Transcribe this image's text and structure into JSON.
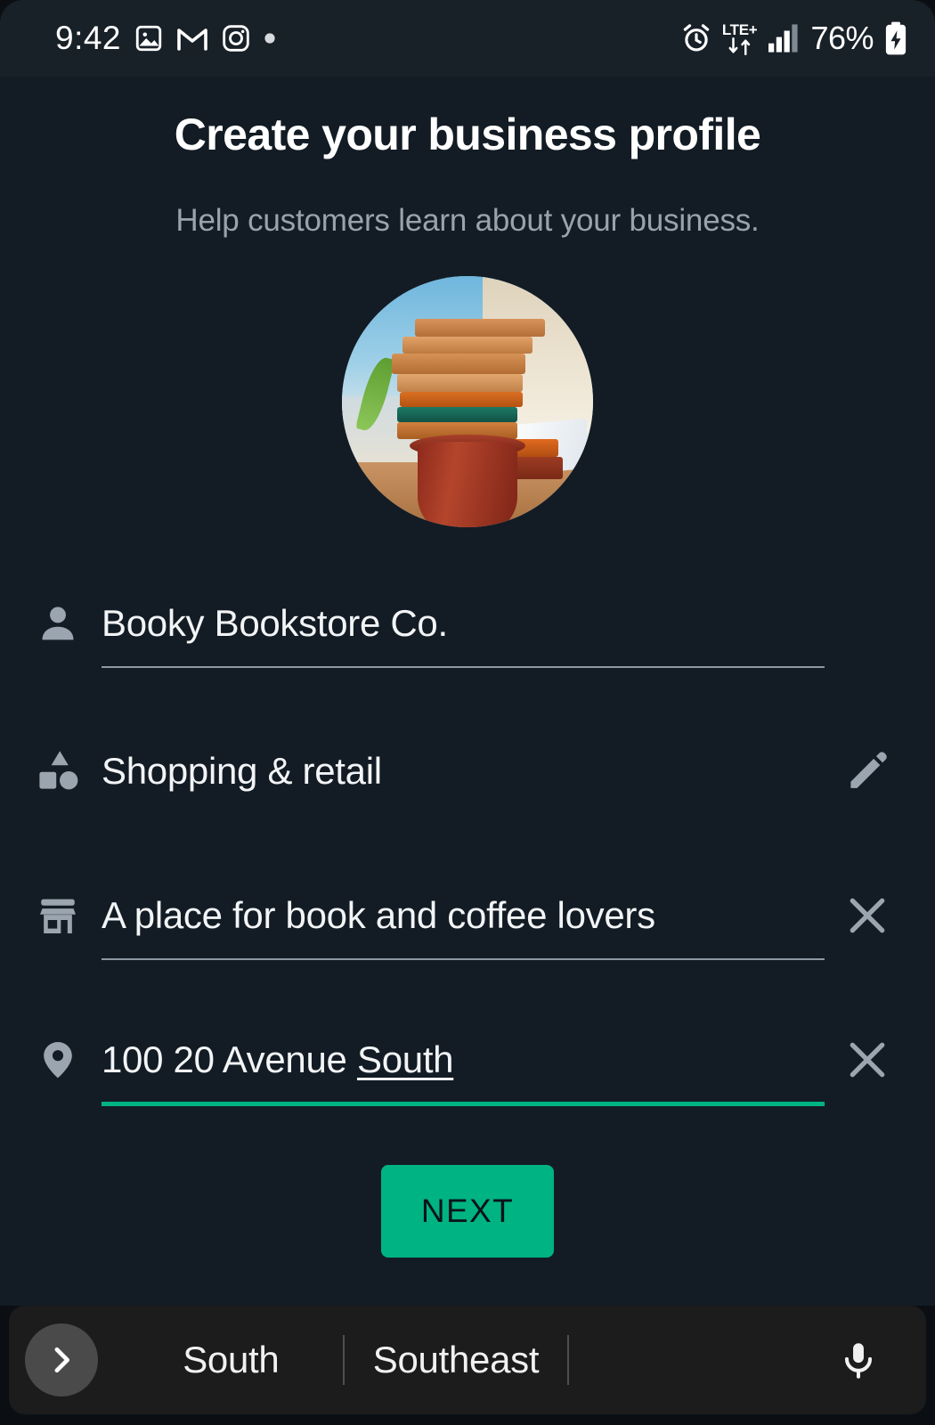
{
  "status_bar": {
    "time": "9:42",
    "left_icons": [
      "photos-icon",
      "gmail-icon",
      "instagram-icon",
      "dot-indicator-icon"
    ],
    "right_icons": [
      "alarm-icon",
      "signal-bars-icon",
      "battery-charging-icon"
    ],
    "network_label": "LTE+",
    "battery_percent": "76%"
  },
  "screen": {
    "title": "Create your business profile",
    "subtitle": "Help customers learn about your business."
  },
  "avatar": {
    "alt": "business-profile-photo"
  },
  "form": {
    "rows": [
      {
        "icon": "person-icon",
        "value": "Booky Bookstore Co.",
        "action": "none",
        "underline": "normal"
      },
      {
        "icon": "category-shapes-icon",
        "value": "Shopping & retail",
        "action": "edit-pencil-icon",
        "underline": "none"
      },
      {
        "icon": "storefront-icon",
        "value": "A place for book and coffee lovers",
        "action": "clear-x-icon",
        "underline": "normal"
      },
      {
        "icon": "location-pin-icon",
        "value": "100 20 Avenue ",
        "value_spellchecked": "South",
        "action": "clear-x-icon",
        "underline": "focused"
      }
    ]
  },
  "next_button": {
    "label": "NEXT"
  },
  "keyboard": {
    "expand_icon": "chevron-right-icon",
    "suggestions": [
      "South",
      "Southeast"
    ],
    "mic_icon": "microphone-icon"
  },
  "colors": {
    "accent_green": "#00b383",
    "background": "#131c24",
    "status_bar_bg": "#182028",
    "keyboard_bg": "#1c1c1c",
    "text_primary": "#f2f4f6",
    "text_secondary": "#9aa3ab",
    "icon_gray": "#9aa5b0"
  }
}
